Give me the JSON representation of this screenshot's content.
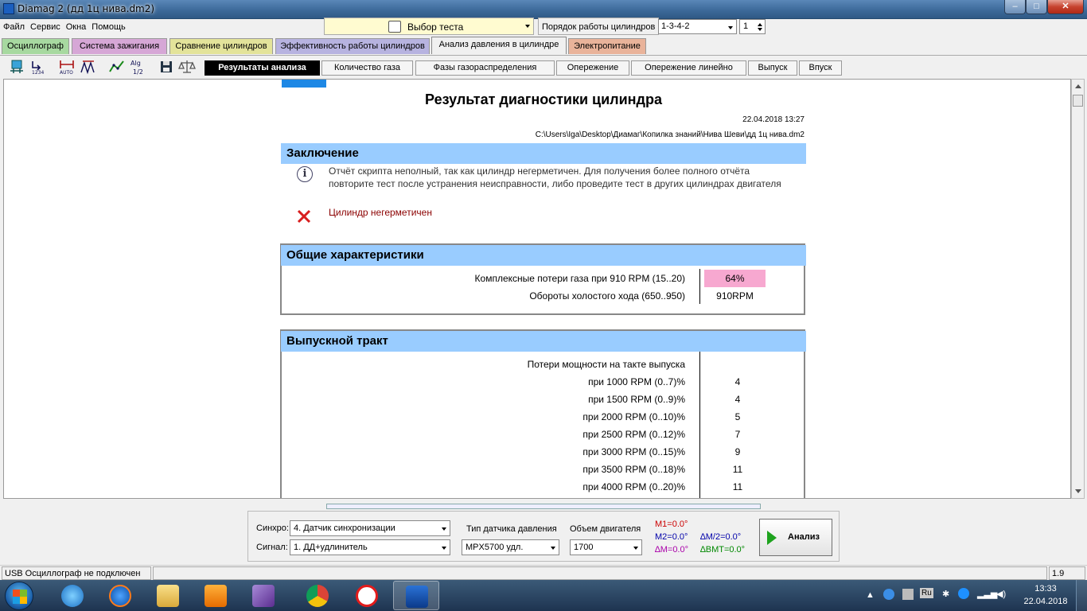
{
  "window": {
    "title": "Diamag 2 (дд 1ц нива.dm2)",
    "min": "–",
    "max": "□",
    "close": "✕"
  },
  "menu": [
    "Файл",
    "Сервис",
    "Окна",
    "Помощь"
  ],
  "test_select": {
    "value": "Выбор теста"
  },
  "cylinder_order": {
    "label": "Порядок работы цилиндров",
    "value": "1-3-4-2",
    "spin_value": "1"
  },
  "main_tabs": [
    "Осциллограф",
    "Система зажигания",
    "Сравнение цилиндров",
    "Эффективность работы цилиндров",
    "Анализ давления в цилиндре",
    "Электропитание"
  ],
  "main_tab_colors": [
    "#a7d9a0",
    "#d6a7d6",
    "#e3e39a",
    "#b7b3e0",
    "#f0f0f0",
    "#e9b39a"
  ],
  "sub_tabs": [
    "Результаты анализа",
    "Количество газа",
    "Фазы газораспределения",
    "Опережение",
    "Опережение линейно",
    "Выпуск",
    "Впуск"
  ],
  "toolbar_icons": [
    "cylinder-icon",
    "numbering-icon",
    "auto-scale-icon",
    "markers-icon",
    "line-graph-icon",
    "algorithm-icon",
    "save-icon",
    "scales-icon"
  ],
  "report": {
    "title": "Результат диагностики цилиндра",
    "date": "22.04.2018 13:27",
    "path": "C:\\Users\\Iga\\Desktop\\Диамаг\\Копилка знаний\\Нива Шеви\\дд 1ц нива.dm2",
    "conclusion": {
      "heading": "Заключение",
      "info": "Отчёт скрипта неполный, так как цилиндр негерметичен. Для получения более полного отчёта повторите тест после устранения неисправности, либо проведите тест в других цилиндрах двигателя",
      "error": "Цилиндр негерметичен"
    },
    "general": {
      "heading": "Общие характеристики",
      "rows": [
        {
          "label": "Комплексные потери газа при 910 RPM (15..20)",
          "value": "64%"
        },
        {
          "label": "Обороты холостого хода (650..950)",
          "value": "910RPM"
        }
      ]
    },
    "exhaust": {
      "heading": "Выпускной тракт",
      "subtitle": "Потери мощности на такте выпуска",
      "rows": [
        {
          "label": "при   1000 RPM (0..7)%",
          "value": "4"
        },
        {
          "label": "при   1500 RPM (0..9)%",
          "value": "4"
        },
        {
          "label": "при   2000 RPM (0..10)%",
          "value": "5"
        },
        {
          "label": "при   2500 RPM (0..12)%",
          "value": "7"
        },
        {
          "label": "при   3000 RPM (0..15)%",
          "value": "9"
        },
        {
          "label": "при   3500 RPM (0..18)%",
          "value": "11"
        },
        {
          "label": "при   4000 RPM (0..20)%",
          "value": "11"
        }
      ]
    }
  },
  "controls": {
    "sync_label": "Синхро:",
    "sync_value": "4.  Датчик синхронизации",
    "signal_label": "Сигнал:",
    "signal_value": "1.  ДД+удлинитель",
    "sensor_label": "Тип датчика давления",
    "sensor_value": "MPX5700 удл.",
    "volume_label": "Объем двигателя",
    "volume_value": "1700",
    "m1": "M1=0.0°",
    "m2": "M2=0.0°",
    "dm": "∆M=0.0°",
    "dm2": "∆M/2=0.0°",
    "dbmt": "∆BMT=0.0°",
    "analyze": "Анализ"
  },
  "status": {
    "usb": "USB Осциллограф не подключен",
    "version": "1.9"
  },
  "taskbar": {
    "apps": [
      "Internet Explorer",
      "CCleaner",
      "Explorer",
      "Media Player",
      "Visual Studio",
      "Chrome",
      "Yandex",
      "Diamag"
    ],
    "tray_lang": "Ru",
    "time": "13:33",
    "date": "22.04.2018"
  },
  "colors": {
    "highlight": "#f7a8d0",
    "section": "#99ccff",
    "error": "#d81e1e"
  }
}
